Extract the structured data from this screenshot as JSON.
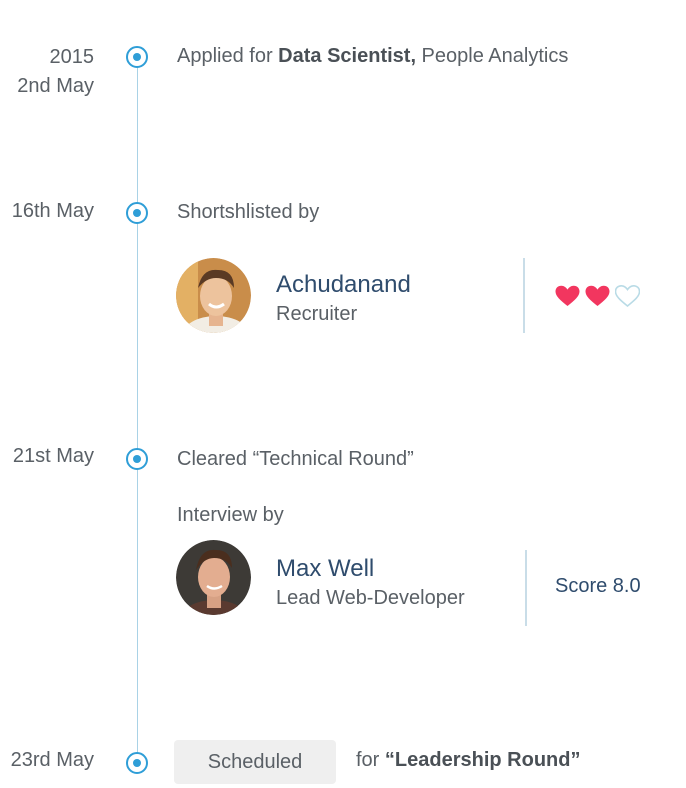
{
  "events": [
    {
      "date_lines": [
        "2015",
        "2nd May"
      ],
      "text_prefix": "Applied for ",
      "text_bold": "Data Scientist,",
      "text_suffix": " People Analytics"
    },
    {
      "date": "16th May",
      "text": "Shortshlisted by",
      "person": {
        "name": "Achudanand",
        "role": "Recruiter",
        "rating": 2,
        "rating_max": 3
      }
    },
    {
      "date": "21st May",
      "text": "Cleared “Technical Round”",
      "subtext": "Interview by",
      "person": {
        "name": "Max Well",
        "role": "Lead Web-Developer",
        "score": "Score 8.0"
      }
    },
    {
      "date": "23rd May",
      "badge": "Scheduled",
      "text_prefix": "for ",
      "text_bold": "“Leadership Round”"
    }
  ],
  "colors": {
    "accent": "#2f9ed7",
    "timeline": "#a9d2e6",
    "heart_filled": "#f2365f",
    "heart_empty": "#b9dbe6",
    "name": "#2f4c6d"
  },
  "icons": {
    "node": "timeline-dot-icon",
    "rating": "heart-icon"
  }
}
